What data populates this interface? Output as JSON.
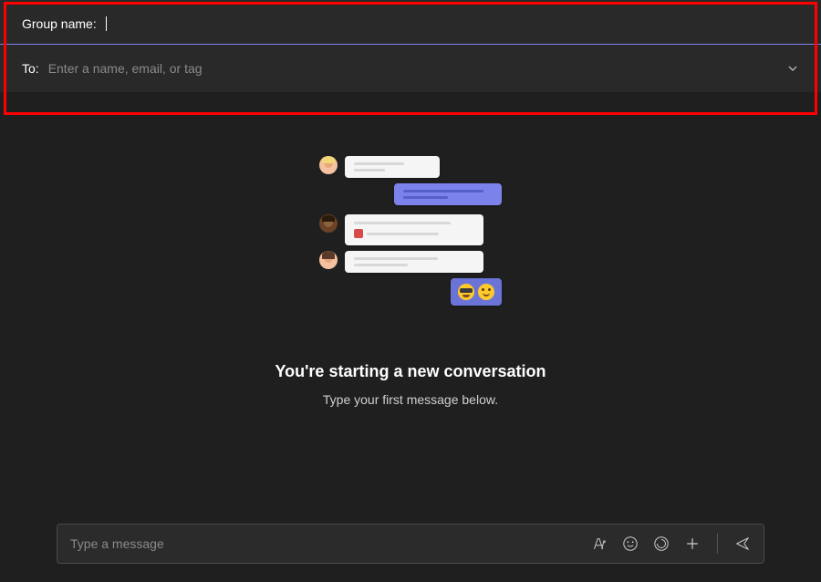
{
  "header": {
    "group_name_label": "Group name:",
    "group_name_value": "",
    "to_label": "To:",
    "to_placeholder": "Enter a name, email, or tag"
  },
  "empty_state": {
    "headline": "You're starting a new conversation",
    "subtext": "Type your first message below."
  },
  "composer": {
    "placeholder": "Type a message"
  },
  "colors": {
    "accent": "#7b83eb",
    "highlight": "#ff0000",
    "bg": "#1f1f1f"
  }
}
